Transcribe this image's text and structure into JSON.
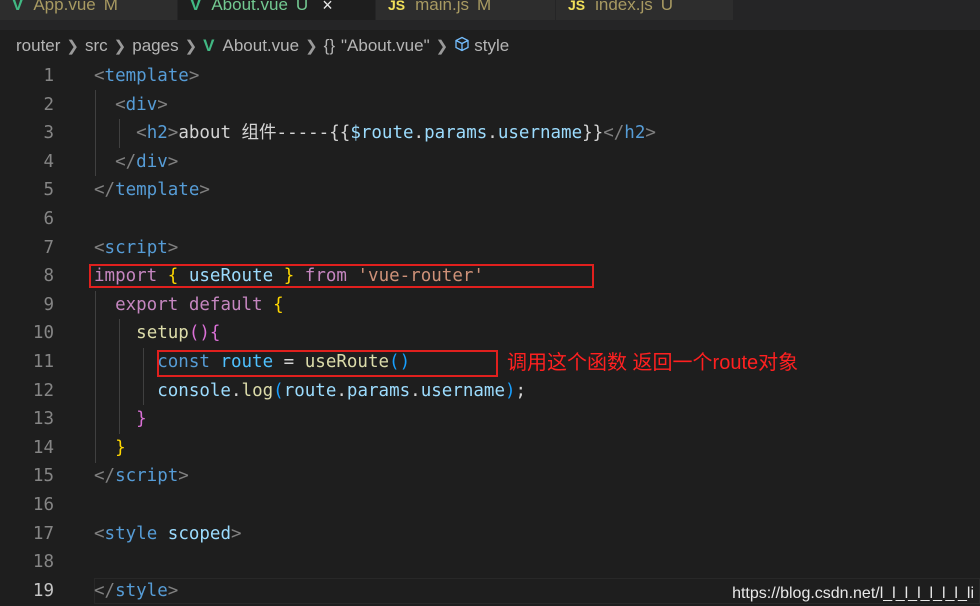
{
  "tabs": [
    {
      "icon": "V",
      "label": "App.vue",
      "status": "M",
      "active": false
    },
    {
      "icon": "V",
      "label": "About.vue",
      "status": "U",
      "active": true,
      "close": "×"
    },
    {
      "icon": "JS",
      "label": "main.js",
      "status": "M",
      "active": false
    },
    {
      "icon": "JS",
      "label": "index.js",
      "status": "U",
      "active": false
    }
  ],
  "breadcrumb": {
    "items": [
      "router",
      "src",
      "pages"
    ],
    "file_icon": "V",
    "file": "About.vue",
    "scope_icon": "{}",
    "scope": "\"About.vue\"",
    "symbol": "style"
  },
  "lines": [
    {
      "num": "1",
      "tokens": [
        [
          "<",
          "t-punct"
        ],
        [
          "template",
          "t-tag"
        ],
        [
          ">",
          "t-punct"
        ]
      ]
    },
    {
      "num": "2",
      "tokens": [
        [
          "  ",
          ""
        ],
        [
          "<",
          "t-punct"
        ],
        [
          "div",
          "t-tag"
        ],
        [
          ">",
          "t-punct"
        ]
      ]
    },
    {
      "num": "3",
      "tokens": [
        [
          "    ",
          ""
        ],
        [
          "<",
          "t-punct"
        ],
        [
          "h2",
          "t-tag"
        ],
        [
          ">",
          "t-punct"
        ],
        [
          "about 组件-----",
          "t-text"
        ],
        [
          "{{",
          "t-text"
        ],
        [
          "$route",
          "t-var"
        ],
        [
          ".",
          "t-text"
        ],
        [
          "params",
          "t-var"
        ],
        [
          ".",
          "t-text"
        ],
        [
          "username",
          "t-var"
        ],
        [
          "}}",
          "t-text"
        ],
        [
          "</",
          "t-punct"
        ],
        [
          "h2",
          "t-tag"
        ],
        [
          ">",
          "t-punct"
        ]
      ]
    },
    {
      "num": "4",
      "tokens": [
        [
          "  ",
          ""
        ],
        [
          "</",
          "t-punct"
        ],
        [
          "div",
          "t-tag"
        ],
        [
          ">",
          "t-punct"
        ]
      ]
    },
    {
      "num": "5",
      "tokens": [
        [
          "</",
          "t-punct"
        ],
        [
          "template",
          "t-tag"
        ],
        [
          ">",
          "t-punct"
        ]
      ]
    },
    {
      "num": "6",
      "tokens": []
    },
    {
      "num": "7",
      "tokens": [
        [
          "<",
          "t-punct"
        ],
        [
          "script",
          "t-tag"
        ],
        [
          ">",
          "t-punct"
        ]
      ]
    },
    {
      "num": "8",
      "tokens": [
        [
          "import",
          "t-key"
        ],
        [
          " ",
          ""
        ],
        [
          "{",
          "t-bkt"
        ],
        [
          " ",
          ""
        ],
        [
          "useRoute",
          "t-var"
        ],
        [
          " ",
          ""
        ],
        [
          "}",
          "t-bkt"
        ],
        [
          " ",
          ""
        ],
        [
          "from",
          "t-key"
        ],
        [
          " ",
          ""
        ],
        [
          "'vue-router'",
          "t-str"
        ]
      ]
    },
    {
      "num": "9",
      "tokens": [
        [
          "  ",
          ""
        ],
        [
          "export",
          "t-key"
        ],
        [
          " ",
          ""
        ],
        [
          "default",
          "t-key"
        ],
        [
          " ",
          ""
        ],
        [
          "{",
          "t-bkt"
        ]
      ]
    },
    {
      "num": "10",
      "tokens": [
        [
          "    ",
          ""
        ],
        [
          "setup",
          "t-fn"
        ],
        [
          "()",
          "t-bkt2"
        ],
        [
          "{",
          "t-bkt2"
        ]
      ]
    },
    {
      "num": "11",
      "tokens": [
        [
          "      ",
          ""
        ],
        [
          "const",
          "t-tag"
        ],
        [
          " ",
          ""
        ],
        [
          "route",
          "t-const"
        ],
        [
          " = ",
          "t-text"
        ],
        [
          "useRoute",
          "t-fn"
        ],
        [
          "()",
          "t-bkt3"
        ]
      ]
    },
    {
      "num": "12",
      "tokens": [
        [
          "      ",
          ""
        ],
        [
          "console",
          "t-var"
        ],
        [
          ".",
          "t-text"
        ],
        [
          "log",
          "t-fn"
        ],
        [
          "(",
          "t-bkt3"
        ],
        [
          "route",
          "t-var"
        ],
        [
          ".",
          "t-text"
        ],
        [
          "params",
          "t-var"
        ],
        [
          ".",
          "t-text"
        ],
        [
          "username",
          "t-var"
        ],
        [
          ")",
          "t-bkt3"
        ],
        [
          ";",
          "t-text"
        ]
      ]
    },
    {
      "num": "13",
      "tokens": [
        [
          "    ",
          ""
        ],
        [
          "}",
          "t-bkt2"
        ]
      ]
    },
    {
      "num": "14",
      "tokens": [
        [
          "  ",
          ""
        ],
        [
          "}",
          "t-bkt"
        ]
      ]
    },
    {
      "num": "15",
      "tokens": [
        [
          "</",
          "t-punct"
        ],
        [
          "script",
          "t-tag"
        ],
        [
          ">",
          "t-punct"
        ]
      ]
    },
    {
      "num": "16",
      "tokens": []
    },
    {
      "num": "17",
      "tokens": [
        [
          "<",
          "t-punct"
        ],
        [
          "style",
          "t-tag"
        ],
        [
          " ",
          ""
        ],
        [
          "scoped",
          "t-attr"
        ],
        [
          ">",
          "t-punct"
        ]
      ]
    },
    {
      "num": "18",
      "tokens": []
    },
    {
      "num": "19",
      "tokens": [
        [
          "</",
          "t-punct"
        ],
        [
          "style",
          "t-tag"
        ],
        [
          ">",
          "t-punct"
        ]
      ]
    }
  ],
  "current_line": "19",
  "annotation": "调用这个函数 返回一个route对象",
  "watermark": "https://blog.csdn.net/l_l_l_l_l_l_l_li",
  "colors": {
    "background": "#1e1e1e",
    "highlight_box": "#e0201e",
    "annotation_text": "#ff2020"
  }
}
